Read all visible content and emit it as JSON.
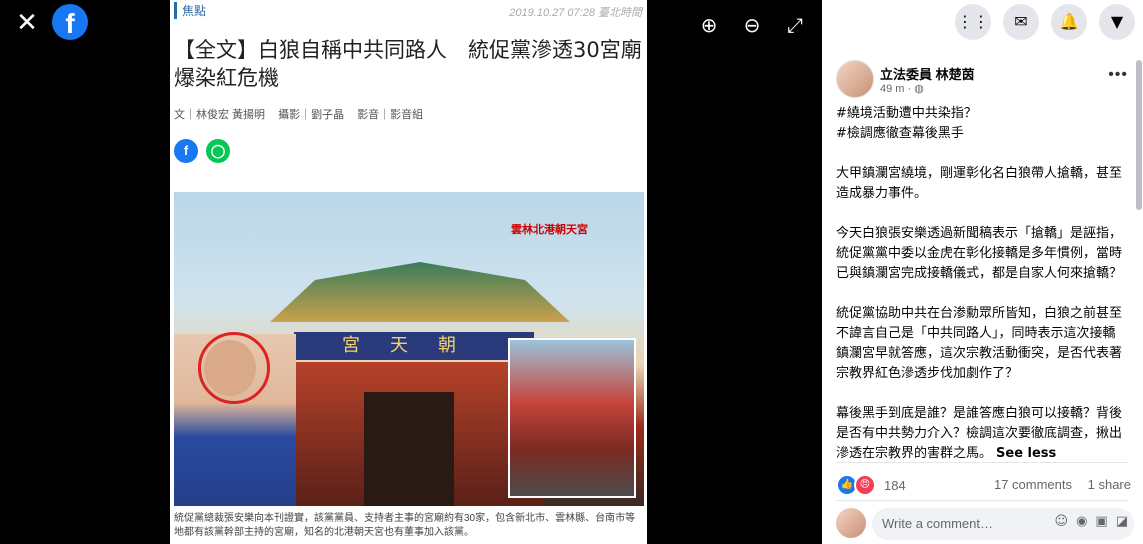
{
  "viewer": {
    "close_icon": "close-icon",
    "logo_letter": "f",
    "tools": [
      {
        "name": "zoom-in-icon",
        "glyph": "⊕"
      },
      {
        "name": "zoom-out-icon",
        "glyph": "⊖"
      },
      {
        "name": "fullscreen-icon",
        "glyph": "⤢"
      }
    ]
  },
  "article": {
    "section": "焦點",
    "date": "2019.10.27 07:28 臺北時間",
    "headline": "【全文】白狼自稱中共同路人　統促黨滲透30宮廟爆染紅危機",
    "credits": [
      "文｜林俊宏 黃揚明",
      "攝影｜劉子晶",
      "影音｜影音組"
    ],
    "image_label": "雲林北港朝天宮",
    "temple_sign": "宮天朝",
    "caption": "統促黨總裁張安樂向本刊證實，該黨黨員、支持者主事的宮廟約有30家，包含新北市、雲林縣、台南市等地都有該黨幹部主持的宮廟，知名的北港朝天宮也有董事加入該黨。"
  },
  "topbar": {
    "buttons": [
      {
        "name": "menu-grid-icon",
        "glyph": "⋮⋮"
      },
      {
        "name": "messenger-icon",
        "glyph": "✉"
      },
      {
        "name": "notifications-icon",
        "glyph": "🔔"
      },
      {
        "name": "account-icon",
        "glyph": "▼"
      }
    ]
  },
  "post": {
    "author": "立法委員 林楚茵",
    "time": "49 m · ◍",
    "paragraphs": [
      "#繞境活動遭中共染指？\n#檢調應徹查幕後黑手",
      "大甲鎮瀾宮繞境，剛運彰化名白狼帶人搶轎，甚至造成暴力事件。",
      "今天白狼張安樂透過新聞稿表示「搶轎」是誣指，統促黨黨中委以金虎在彰化接轎是多年慣例，當時已與鎮瀾宮完成接轎儀式，都是自家人何來搶轎？",
      "統促黨協助中共在台渗勳眾所皆知，白狼之前甚至不諱言自己是「中共同路人」，同時表示這次接轎鎮瀾宮早就答應，這次宗教活動衝突，是否代表著宗教界紅色滲透步伐加劇作了？",
      "幕後黑手到底是誰？是誰答應白狼可以接轎？背後是否有中共勢力介入？檢調這次要徹底調查，揪出滲透在宗教界的害群之馬。"
    ],
    "see_less": "See less",
    "reaction_count": "184",
    "comments": "17 comments",
    "shares": "1 share",
    "comment_placeholder": "Write a comment…"
  }
}
